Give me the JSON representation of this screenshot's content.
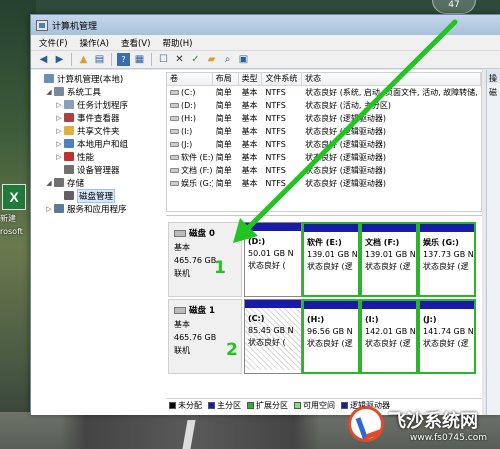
{
  "desktop": {
    "icon_label": "新建",
    "icon_label2": "rosoft",
    "clock_text": "47"
  },
  "window": {
    "title": "计算机管理"
  },
  "menu": [
    "文件(F)",
    "操作(A)",
    "查看(V)",
    "帮助(H)"
  ],
  "tree": [
    {
      "label": "计算机管理(本地)",
      "indent": 0,
      "expander": "",
      "icon": "computer-icon",
      "color": "#6a8fb8"
    },
    {
      "label": "系统工具",
      "indent": 1,
      "expander": "◢",
      "icon": "tools-icon",
      "color": "#7a8a9a"
    },
    {
      "label": "任务计划程序",
      "indent": 2,
      "expander": "▷",
      "icon": "clock-icon",
      "color": "#8aa0b8"
    },
    {
      "label": "事件查看器",
      "indent": 2,
      "expander": "▷",
      "icon": "event-icon",
      "color": "#b04040"
    },
    {
      "label": "共享文件夹",
      "indent": 2,
      "expander": "▷",
      "icon": "folder-icon",
      "color": "#e0b040"
    },
    {
      "label": "本地用户和组",
      "indent": 2,
      "expander": "▷",
      "icon": "users-icon",
      "color": "#5080c0"
    },
    {
      "label": "性能",
      "indent": 2,
      "expander": "▷",
      "icon": "performance-icon",
      "color": "#c03030"
    },
    {
      "label": "设备管理器",
      "indent": 2,
      "expander": "",
      "icon": "device-icon",
      "color": "#707070"
    },
    {
      "label": "存储",
      "indent": 1,
      "expander": "◢",
      "icon": "storage-icon",
      "color": "#707070"
    },
    {
      "label": "磁盘管理",
      "indent": 2,
      "expander": "",
      "icon": "disk-icon",
      "color": "#606060",
      "selected": true
    },
    {
      "label": "服务和应用程序",
      "indent": 1,
      "expander": "▷",
      "icon": "services-icon",
      "color": "#5a7a9a"
    }
  ],
  "volumes": {
    "headers": [
      "卷",
      "布局",
      "类型",
      "文件系统",
      "状态"
    ],
    "rows": [
      [
        "(C:)",
        "简单",
        "基本",
        "NTFS",
        "状态良好 (系统, 启动, 页面文件, 活动, 故障转储,"
      ],
      [
        "(D:)",
        "简单",
        "基本",
        "NTFS",
        "状态良好 (活动, 主分区)"
      ],
      [
        "(H:)",
        "简单",
        "基本",
        "NTFS",
        "状态良好 (逻辑驱动器)"
      ],
      [
        "(I:)",
        "简单",
        "基本",
        "NTFS",
        "状态良好 (逻辑驱动器)"
      ],
      [
        "(J:)",
        "简单",
        "基本",
        "NTFS",
        "状态良好 (逻辑驱动器)"
      ],
      [
        "软件 (E:)",
        "简单",
        "基本",
        "NTFS",
        "状态良好 (逻辑驱动器)"
      ],
      [
        "文档 (F:)",
        "简单",
        "基本",
        "NTFS",
        "状态良好 (逻辑驱动器)"
      ],
      [
        "娱乐 (G:)",
        "简单",
        "基本",
        "NTFS",
        "状态良好 (逻辑驱动器)"
      ]
    ]
  },
  "disks": [
    {
      "name": "磁盘 0",
      "type": "基本",
      "size": "465.76 GB",
      "status": "联机",
      "partitions": [
        {
          "name": "(D:)",
          "size": "50.01 GB N",
          "state": "状态良好 (",
          "bar": "#1a1aa8",
          "ext": false,
          "unalloc": false
        },
        {
          "name": "软件 (E:)",
          "size": "139.01 GB N",
          "state": "状态良好 (逻",
          "bar": "#1a1aa8",
          "ext": true,
          "unalloc": false
        },
        {
          "name": "文档 (F:)",
          "size": "139.01 GB N",
          "state": "状态良好 (逻",
          "bar": "#1a1aa8",
          "ext": true,
          "unalloc": false
        },
        {
          "name": "娱乐 (G:)",
          "size": "137.73 GB N",
          "state": "状态良好 (逻",
          "bar": "#1a1aa8",
          "ext": true,
          "unalloc": false
        }
      ]
    },
    {
      "name": "磁盘 1",
      "type": "基本",
      "size": "465.76 GB",
      "status": "联机",
      "partitions": [
        {
          "name": "(C:)",
          "size": "85.45 GB N",
          "state": "状态良好 (",
          "bar": "#1a1aa8",
          "ext": false,
          "unalloc": true
        },
        {
          "name": "(H:)",
          "size": "96.56 GB N",
          "state": "状态良好 (逻",
          "bar": "#1a1aa8",
          "ext": true,
          "unalloc": false
        },
        {
          "name": "(I:)",
          "size": "142.01 GB N",
          "state": "状态良好 (逻",
          "bar": "#1a1aa8",
          "ext": true,
          "unalloc": false
        },
        {
          "name": "(J:)",
          "size": "141.74 GB N",
          "state": "状态良好 (逻",
          "bar": "#1a1aa8",
          "ext": true,
          "unalloc": false
        }
      ]
    }
  ],
  "legend": [
    {
      "label": "未分配",
      "color": "#000000"
    },
    {
      "label": "主分区",
      "color": "#1a1aa8"
    },
    {
      "label": "扩展分区",
      "color": "#2bb52b"
    },
    {
      "label": "可用空间",
      "color": "#7fe07f"
    },
    {
      "label": "逻辑驱动器",
      "color": "#1a1aa8"
    }
  ],
  "actions": {
    "header": "操",
    "item": "磁"
  },
  "annotations": {
    "num1": "1",
    "num2": "2",
    "arrow_color": "#21c421"
  },
  "watermark": {
    "title": "飞沙系统网",
    "url": "www.fs0745.com"
  }
}
